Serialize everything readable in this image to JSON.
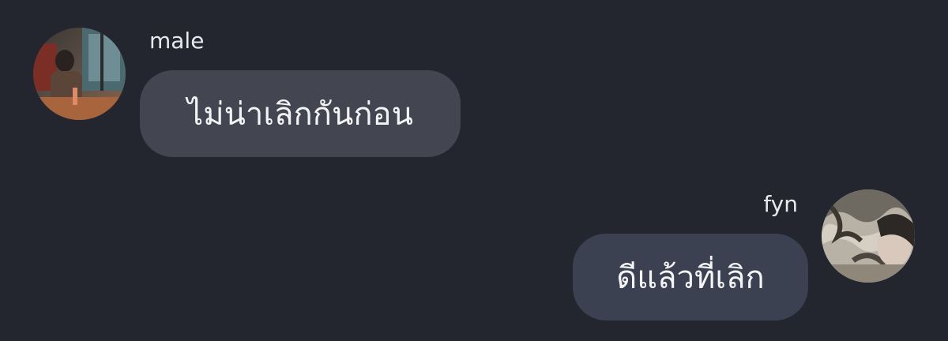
{
  "messages": [
    {
      "sender": "male",
      "text": "ไม่น่าเลิกกันก่อน",
      "side": "left",
      "avatar": "user-avatar-male"
    },
    {
      "sender": "fyn",
      "text": "ดีแล้วที่เลิก",
      "side": "right",
      "avatar": "user-avatar-fyn"
    }
  ],
  "colors": {
    "background": "#23252f",
    "incoming_bubble": "#434650",
    "outgoing_bubble": "#3b4150",
    "text": "#f4f4f6"
  }
}
